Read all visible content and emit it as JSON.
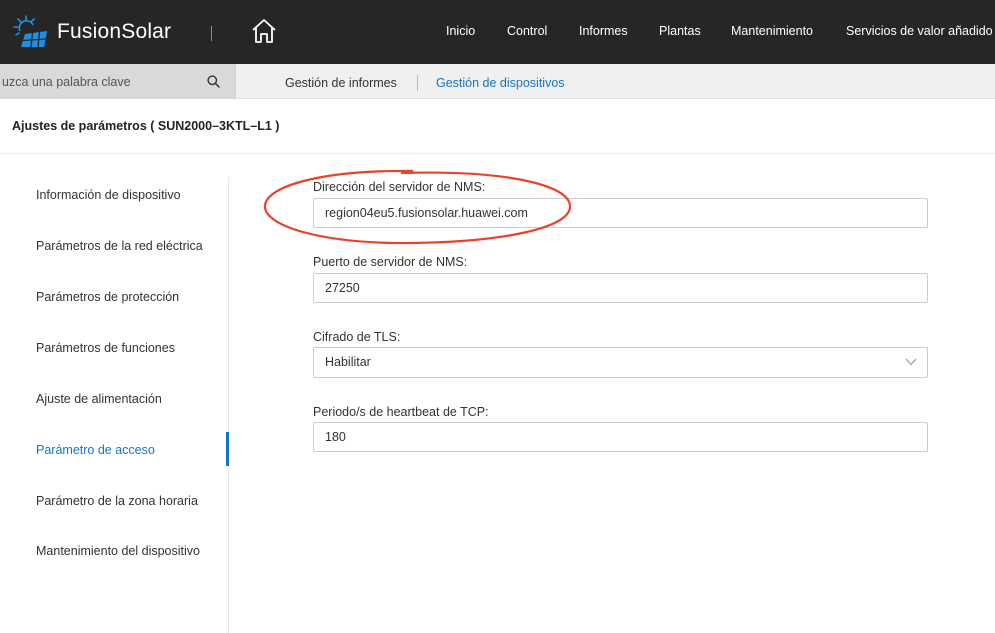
{
  "app": {
    "logo_text": "FusionSolar",
    "logo_color": "#1f8fe6"
  },
  "nav": {
    "items": [
      {
        "label": "Inicio"
      },
      {
        "label": "Control"
      },
      {
        "label": "Informes"
      },
      {
        "label": "Plantas"
      },
      {
        "label": "Mantenimiento"
      },
      {
        "label": "Servicios de valor añadido"
      }
    ]
  },
  "search": {
    "placeholder": "uzca una palabra clave"
  },
  "subtabs": {
    "reports": "Gestión de informes",
    "devices": "Gestión de dispositivos"
  },
  "page": {
    "title": "Ajustes de parámetros ( SUN2000–3KTL–L1 )"
  },
  "sidebar": {
    "items": [
      {
        "label": "Información de dispositivo"
      },
      {
        "label": "Parámetros de la red eléctrica"
      },
      {
        "label": "Parámetros de protección"
      },
      {
        "label": "Parámetros de funciones"
      },
      {
        "label": "Ajuste de alimentación"
      },
      {
        "label": "Parámetro de acceso"
      },
      {
        "label": "Parámetro de la zona horaria"
      },
      {
        "label": "Mantenimiento del dispositivo"
      }
    ],
    "active_index": 5
  },
  "form": {
    "nms_address_label": "Dirección del servidor de NMS:",
    "nms_address_value": "region04eu5.fusionsolar.huawei.com",
    "nms_port_label": "Puerto de servidor de NMS:",
    "nms_port_value": "27250",
    "tls_label": "Cifrado de TLS:",
    "tls_value": "Habilitar",
    "heartbeat_label": "Periodo/s de heartbeat de TCP:",
    "heartbeat_value": "180"
  },
  "colors": {
    "accent": "#1476c8",
    "topbar": "#262626",
    "annotation": "#e8412c"
  }
}
